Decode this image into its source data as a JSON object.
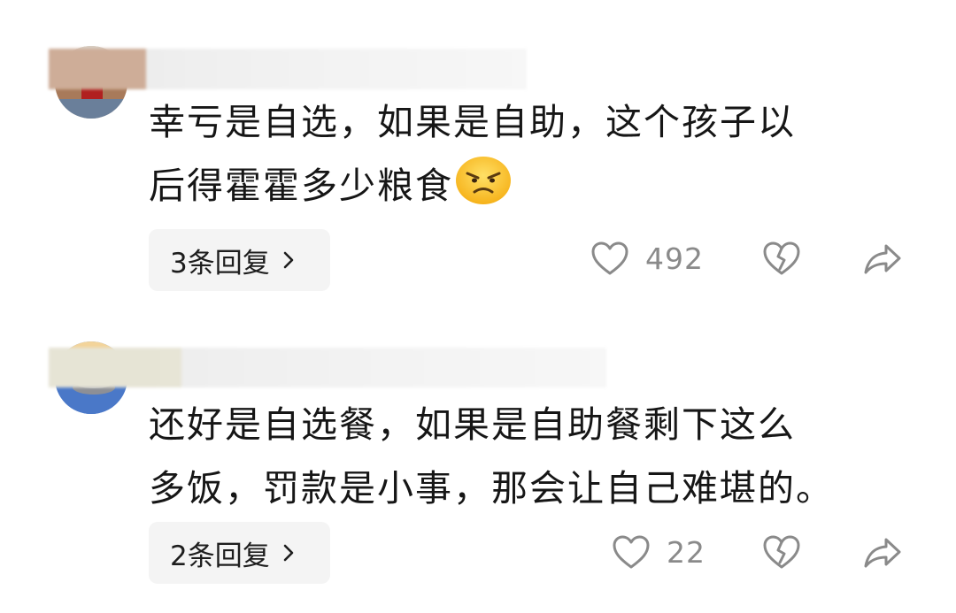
{
  "comments": [
    {
      "text": "幸亏是自选，如果是自助，这个孩子以\n后得霍霍多少粮食",
      "emoji_icon": "annoyed-face-icon",
      "reply_label": "3条回复",
      "likes": "492"
    },
    {
      "text": "还好是自选餐，如果是自助餐剩下这么\n多饭，罚款是小事，那会让自己难堪的。",
      "reply_label": "2条回复",
      "likes": "22"
    }
  ],
  "icons": {
    "like": "heart-outline-icon",
    "dislike": "broken-heart-icon",
    "share": "share-arrow-icon",
    "reply_chevron": "chevron-right-icon"
  },
  "colors": {
    "text": "#161616",
    "count": "#8a8a8a",
    "reply_bg": "#f4f4f4",
    "icon": "#8a8a8a"
  }
}
